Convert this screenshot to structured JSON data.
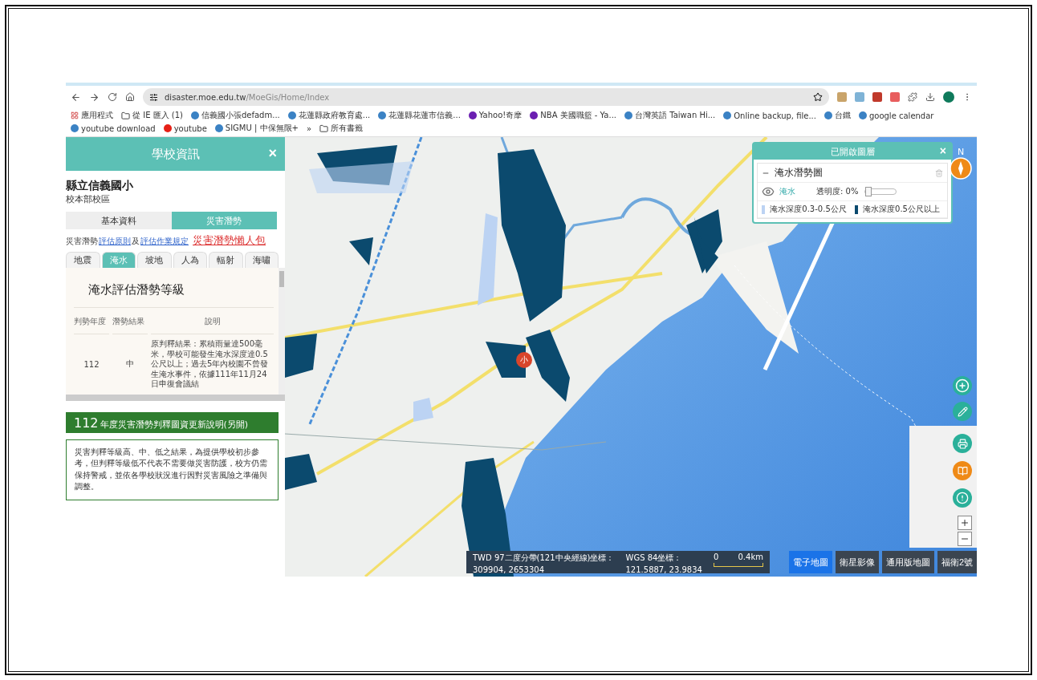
{
  "browser": {
    "url_host": "disaster.moe.edu.tw",
    "url_path": "/MoeGis/Home/Index",
    "bookmarks": [
      {
        "kind": "apps",
        "label": "應用程式"
      },
      {
        "kind": "folder",
        "label": "從 IE 匯入 (1)"
      },
      {
        "kind": "site",
        "label": "信義國小張defadm..."
      },
      {
        "kind": "site",
        "label": "花蓮縣政府教育處..."
      },
      {
        "kind": "site",
        "label": "花蓮縣花蓮市信義..."
      },
      {
        "kind": "yahoo",
        "label": "Yahoo!奇摩"
      },
      {
        "kind": "yahoo",
        "label": "NBA 美國職籃 - Ya..."
      },
      {
        "kind": "site",
        "label": "台灣英語 Taiwan Hi..."
      },
      {
        "kind": "site",
        "label": "Online backup, file..."
      },
      {
        "kind": "site",
        "label": "台鐵"
      },
      {
        "kind": "site",
        "label": "google calendar"
      },
      {
        "kind": "site",
        "label": "youtube download"
      },
      {
        "kind": "video",
        "label": "youtube"
      },
      {
        "kind": "site",
        "label": "SIGMU | 中保無限+"
      }
    ],
    "more": "»",
    "all_bookmarks": "所有書籤"
  },
  "school_panel": {
    "title": "學校資訊",
    "close": "×",
    "school_name": "縣立信義國小",
    "campus": "校本部校區",
    "tabs": [
      {
        "label": "基本資料",
        "selected": false
      },
      {
        "label": "災害潛勢",
        "selected": true
      }
    ],
    "links": {
      "prefix": "災害潛勢",
      "link1": "評估原則",
      "joiner": "及",
      "link2": "評估作業規定",
      "guide": "災害潛勢懶人包"
    },
    "hazard_tabs": [
      {
        "label": "地震",
        "selected": false
      },
      {
        "label": "淹水",
        "selected": true
      },
      {
        "label": "坡地",
        "selected": false
      },
      {
        "label": "人為",
        "selected": false
      },
      {
        "label": "輻射",
        "selected": false
      },
      {
        "label": "海嘯",
        "selected": false
      }
    ],
    "section_title": "淹水評估潛勢等級",
    "table": {
      "columns": [
        "判勢年度",
        "潛勢結果",
        "說明"
      ],
      "rows": [
        [
          "112",
          "中",
          "原判釋結果：累積雨量達500毫米，學校可能發生淹水深度達0.5公尺以上；過去5年內校園不曾發生淹水事件，依據111年11月24日申復會議結"
        ]
      ]
    },
    "update_banner": {
      "year": "112",
      "text": "年度災害潛勢判釋圖資更新說明(另開)"
    },
    "note": "災害判釋等級高、中、低之結果，為提供學校初步參考，但判釋等級低不代表不需要做災害防護，校方仍需保持警戒，並依各學校狀況進行因對災害風險之準備與調整。"
  },
  "layer_panel": {
    "title": "已開啟圖層",
    "close": "×",
    "layer_name": "淹水潛勢圖",
    "visible": true,
    "sublayer": "淹水",
    "opacity_label": "透明度: 0%",
    "opacity": {
      "level": 0
    },
    "legend": [
      {
        "label": "淹水深度0.3-0.5公尺",
        "color": "#bcd3f3"
      },
      {
        "label": "淹水深度0.5公尺以上",
        "color": "#0b4a6e"
      }
    ]
  },
  "map": {
    "compass": "N",
    "marker": "小"
  },
  "coordinates": {
    "twd_label": "TWD 97二度分帶(121中央經線)坐標：",
    "twd_value": "309904, 2653304",
    "wgs_label": "WGS 84坐標：",
    "wgs_value": "121.5887, 23.9834",
    "scale_start": "0",
    "scale_end": "0.4km"
  },
  "basemaps": [
    {
      "label": "電子地圖",
      "selected": true
    },
    {
      "label": "衛星影像",
      "selected": false
    },
    {
      "label": "通用版地圖",
      "selected": false
    },
    {
      "label": "福衛2號",
      "selected": false
    }
  ]
}
